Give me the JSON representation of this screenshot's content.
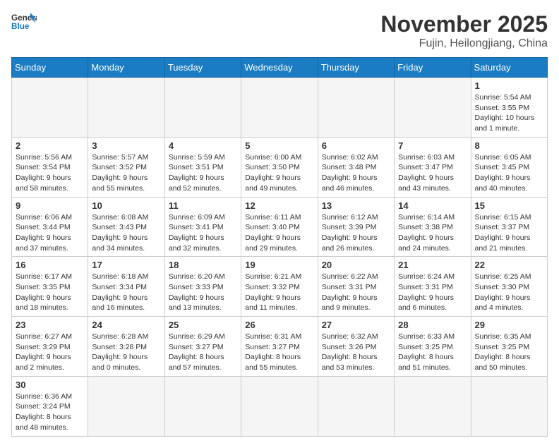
{
  "logo": {
    "text_general": "General",
    "text_blue": "Blue"
  },
  "title": {
    "month_year": "November 2025",
    "location": "Fujin, Heilongjiang, China"
  },
  "days_of_week": [
    "Sunday",
    "Monday",
    "Tuesday",
    "Wednesday",
    "Thursday",
    "Friday",
    "Saturday"
  ],
  "weeks": [
    [
      {
        "day": "",
        "info": ""
      },
      {
        "day": "",
        "info": ""
      },
      {
        "day": "",
        "info": ""
      },
      {
        "day": "",
        "info": ""
      },
      {
        "day": "",
        "info": ""
      },
      {
        "day": "",
        "info": ""
      },
      {
        "day": "1",
        "info": "Sunrise: 5:54 AM\nSunset: 3:55 PM\nDaylight: 10 hours and 1 minute."
      }
    ],
    [
      {
        "day": "2",
        "info": "Sunrise: 5:56 AM\nSunset: 3:54 PM\nDaylight: 9 hours and 58 minutes."
      },
      {
        "day": "3",
        "info": "Sunrise: 5:57 AM\nSunset: 3:52 PM\nDaylight: 9 hours and 55 minutes."
      },
      {
        "day": "4",
        "info": "Sunrise: 5:59 AM\nSunset: 3:51 PM\nDaylight: 9 hours and 52 minutes."
      },
      {
        "day": "5",
        "info": "Sunrise: 6:00 AM\nSunset: 3:50 PM\nDaylight: 9 hours and 49 minutes."
      },
      {
        "day": "6",
        "info": "Sunrise: 6:02 AM\nSunset: 3:48 PM\nDaylight: 9 hours and 46 minutes."
      },
      {
        "day": "7",
        "info": "Sunrise: 6:03 AM\nSunset: 3:47 PM\nDaylight: 9 hours and 43 minutes."
      },
      {
        "day": "8",
        "info": "Sunrise: 6:05 AM\nSunset: 3:45 PM\nDaylight: 9 hours and 40 minutes."
      }
    ],
    [
      {
        "day": "9",
        "info": "Sunrise: 6:06 AM\nSunset: 3:44 PM\nDaylight: 9 hours and 37 minutes."
      },
      {
        "day": "10",
        "info": "Sunrise: 6:08 AM\nSunset: 3:43 PM\nDaylight: 9 hours and 34 minutes."
      },
      {
        "day": "11",
        "info": "Sunrise: 6:09 AM\nSunset: 3:41 PM\nDaylight: 9 hours and 32 minutes."
      },
      {
        "day": "12",
        "info": "Sunrise: 6:11 AM\nSunset: 3:40 PM\nDaylight: 9 hours and 29 minutes."
      },
      {
        "day": "13",
        "info": "Sunrise: 6:12 AM\nSunset: 3:39 PM\nDaylight: 9 hours and 26 minutes."
      },
      {
        "day": "14",
        "info": "Sunrise: 6:14 AM\nSunset: 3:38 PM\nDaylight: 9 hours and 24 minutes."
      },
      {
        "day": "15",
        "info": "Sunrise: 6:15 AM\nSunset: 3:37 PM\nDaylight: 9 hours and 21 minutes."
      }
    ],
    [
      {
        "day": "16",
        "info": "Sunrise: 6:17 AM\nSunset: 3:35 PM\nDaylight: 9 hours and 18 minutes."
      },
      {
        "day": "17",
        "info": "Sunrise: 6:18 AM\nSunset: 3:34 PM\nDaylight: 9 hours and 16 minutes."
      },
      {
        "day": "18",
        "info": "Sunrise: 6:20 AM\nSunset: 3:33 PM\nDaylight: 9 hours and 13 minutes."
      },
      {
        "day": "19",
        "info": "Sunrise: 6:21 AM\nSunset: 3:32 PM\nDaylight: 9 hours and 11 minutes."
      },
      {
        "day": "20",
        "info": "Sunrise: 6:22 AM\nSunset: 3:31 PM\nDaylight: 9 hours and 9 minutes."
      },
      {
        "day": "21",
        "info": "Sunrise: 6:24 AM\nSunset: 3:31 PM\nDaylight: 9 hours and 6 minutes."
      },
      {
        "day": "22",
        "info": "Sunrise: 6:25 AM\nSunset: 3:30 PM\nDaylight: 9 hours and 4 minutes."
      }
    ],
    [
      {
        "day": "23",
        "info": "Sunrise: 6:27 AM\nSunset: 3:29 PM\nDaylight: 9 hours and 2 minutes."
      },
      {
        "day": "24",
        "info": "Sunrise: 6:28 AM\nSunset: 3:28 PM\nDaylight: 9 hours and 0 minutes."
      },
      {
        "day": "25",
        "info": "Sunrise: 6:29 AM\nSunset: 3:27 PM\nDaylight: 8 hours and 57 minutes."
      },
      {
        "day": "26",
        "info": "Sunrise: 6:31 AM\nSunset: 3:27 PM\nDaylight: 8 hours and 55 minutes."
      },
      {
        "day": "27",
        "info": "Sunrise: 6:32 AM\nSunset: 3:26 PM\nDaylight: 8 hours and 53 minutes."
      },
      {
        "day": "28",
        "info": "Sunrise: 6:33 AM\nSunset: 3:25 PM\nDaylight: 8 hours and 51 minutes."
      },
      {
        "day": "29",
        "info": "Sunrise: 6:35 AM\nSunset: 3:25 PM\nDaylight: 8 hours and 50 minutes."
      }
    ],
    [
      {
        "day": "30",
        "info": "Sunrise: 6:36 AM\nSunset: 3:24 PM\nDaylight: 8 hours and 48 minutes."
      },
      {
        "day": "",
        "info": ""
      },
      {
        "day": "",
        "info": ""
      },
      {
        "day": "",
        "info": ""
      },
      {
        "day": "",
        "info": ""
      },
      {
        "day": "",
        "info": ""
      },
      {
        "day": "",
        "info": ""
      }
    ]
  ]
}
